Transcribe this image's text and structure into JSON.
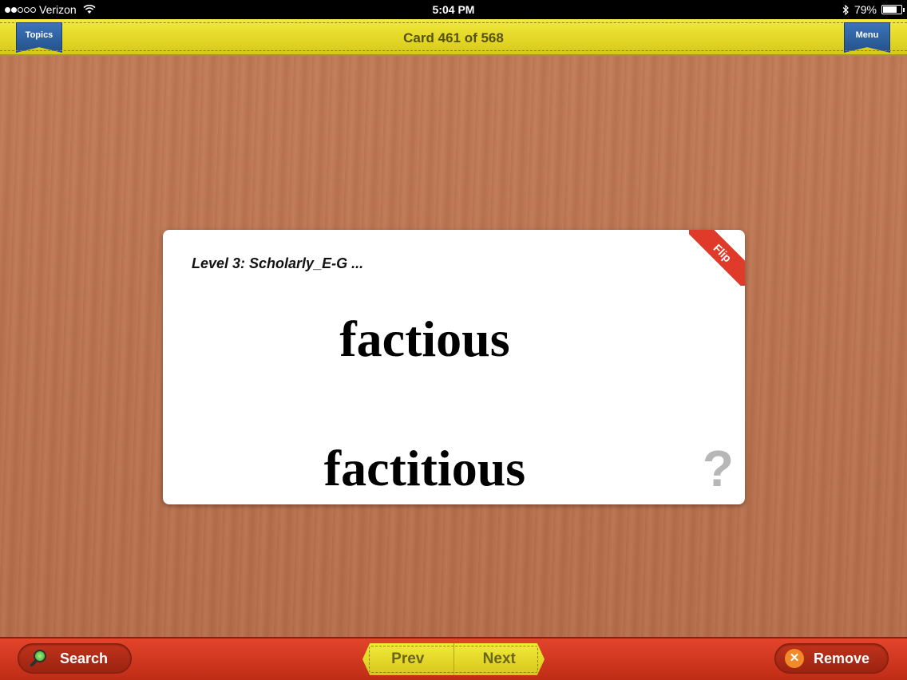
{
  "status_bar": {
    "carrier": "Verizon",
    "signal_dots_filled": 2,
    "signal_dots_total": 5,
    "time": "5:04 PM",
    "battery": "79%",
    "battery_level": 0.79
  },
  "top_bar": {
    "topics_label": "Topics",
    "card_counter": "Card 461 of 568",
    "menu_label": "Menu"
  },
  "card": {
    "topic": "Level 3: Scholarly_E-G ...",
    "word_one": "factious",
    "word_two": "factitious",
    "flip_label": "Flip",
    "hint_symbol": "?"
  },
  "bottom_bar": {
    "search_label": "Search",
    "prev_label": "Prev",
    "next_label": "Next",
    "remove_label": "Remove"
  },
  "colors": {
    "top_bar": "#e6d92a",
    "bottom_bar": "#d33a22",
    "ribbon": "#2f63a3",
    "flip_band": "#e03a2a"
  },
  "icons": {
    "search": "search-icon",
    "remove": "close-icon",
    "hint": "question-icon",
    "wifi": "wifi-icon",
    "bluetooth": "bluetooth-icon",
    "battery": "battery-icon"
  }
}
